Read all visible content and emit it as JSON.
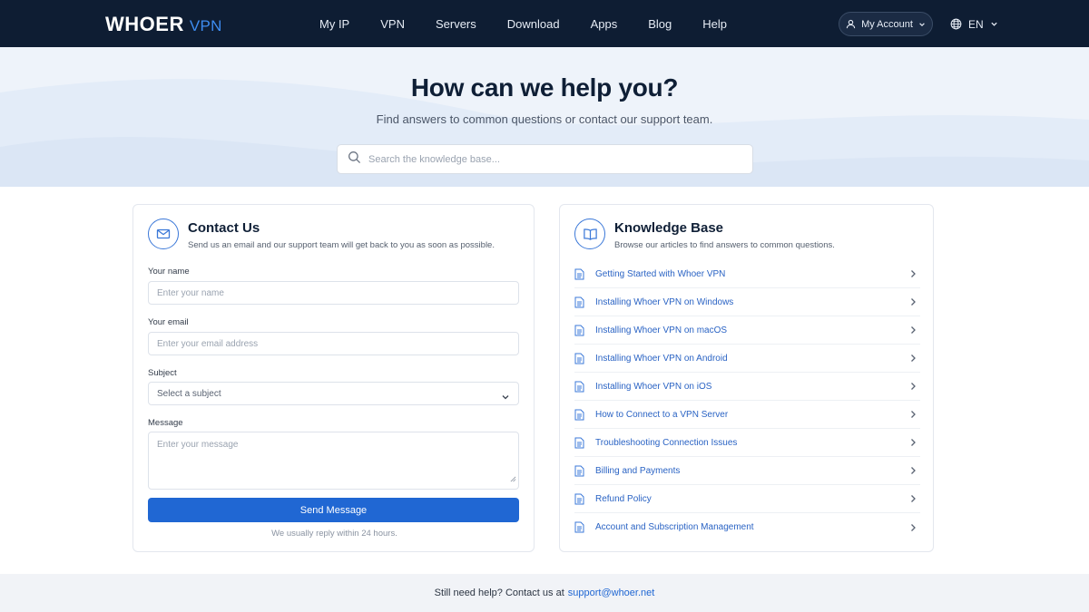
{
  "nav": {
    "logo_main": "WHOER",
    "logo_sub": "VPN",
    "links": [
      "My IP",
      "VPN",
      "Servers",
      "Download",
      "Apps",
      "Blog",
      "Help"
    ],
    "account_label": "My Account",
    "language": "EN"
  },
  "hero": {
    "title": "How can we help you?",
    "subtitle": "Find answers to common questions or contact our support team.",
    "search_placeholder": "Search the knowledge base..."
  },
  "contact": {
    "title": "Contact Us",
    "subtitle": "Send us an email and our support team will get back to you as soon as possible.",
    "name_label": "Your name",
    "name_placeholder": "Enter your name",
    "email_label": "Your email",
    "email_placeholder": "Enter your email address",
    "subject_label": "Subject",
    "subject_value": "Select a subject",
    "message_label": "Message",
    "message_placeholder": "Enter your message",
    "send_label": "Send Message",
    "reply_note": "We usually reply within 24 hours."
  },
  "kb": {
    "title": "Knowledge Base",
    "subtitle": "Browse our articles to find answers to common questions.",
    "articles": [
      "Getting Started with Whoer VPN",
      "Installing Whoer VPN on Windows",
      "Installing Whoer VPN on macOS",
      "Installing Whoer VPN on Android",
      "Installing Whoer VPN on iOS",
      "How to Connect to a VPN Server",
      "Troubleshooting Connection Issues",
      "Billing and Payments",
      "Refund Policy",
      "Account and Subscription Management"
    ]
  },
  "footer": {
    "text": "Still need help? Contact us at",
    "email": "support@whoer.net"
  },
  "colors": {
    "nav_bg": "#0e1d33",
    "accent": "#2067d3",
    "link": "#2a63c4"
  }
}
